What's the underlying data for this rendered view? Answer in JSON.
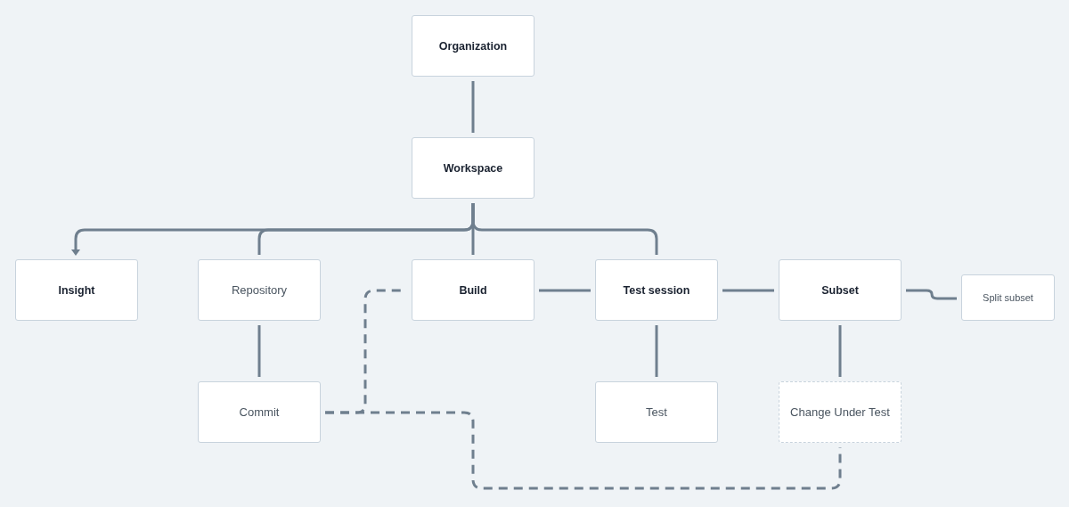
{
  "nodes": [
    {
      "label": "Organization",
      "kind": "primary"
    },
    {
      "label": "Workspace",
      "kind": "primary"
    },
    {
      "label": "Insight",
      "kind": "primary"
    },
    {
      "label": "Repository",
      "kind": "secondary"
    },
    {
      "label": "Build",
      "kind": "primary"
    },
    {
      "label": "Test session",
      "kind": "primary"
    },
    {
      "label": "Subset",
      "kind": "primary"
    },
    {
      "label": "Split subset",
      "kind": "small"
    },
    {
      "label": "Commit",
      "kind": "secondary"
    },
    {
      "label": "Test",
      "kind": "secondary"
    },
    {
      "label": "Change Under Test",
      "kind": "dashed"
    }
  ]
}
